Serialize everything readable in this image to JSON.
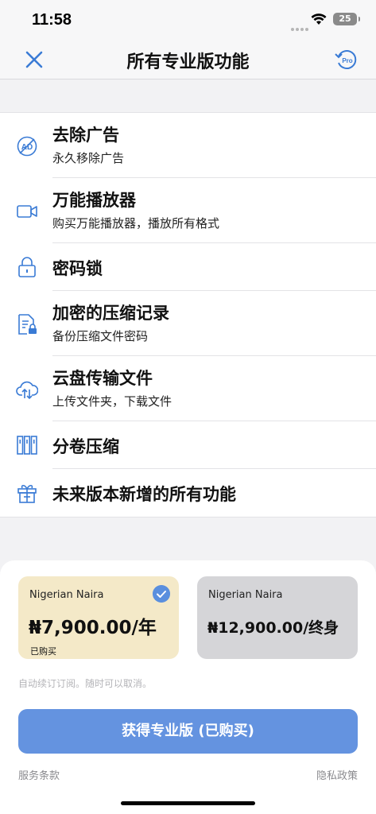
{
  "status_bar": {
    "time": "11:58",
    "battery": "25"
  },
  "nav": {
    "title": "所有专业版功能"
  },
  "features": [
    {
      "icon": "no-ads-icon",
      "title": "去除广告",
      "subtitle": "永久移除广告"
    },
    {
      "icon": "video-camera-icon",
      "title": "万能播放器",
      "subtitle": "购买万能播放器，播放所有格式"
    },
    {
      "icon": "lock-icon",
      "title": "密码锁"
    },
    {
      "icon": "encrypted-file-icon",
      "title": "加密的压缩记录",
      "subtitle": "备份压缩文件密码"
    },
    {
      "icon": "cloud-transfer-icon",
      "title": "云盘传输文件",
      "subtitle": "上传文件夹，下载文件"
    },
    {
      "icon": "split-volumes-icon",
      "title": "分卷压缩"
    },
    {
      "icon": "gift-icon",
      "title": "未来版本新增的所有功能"
    }
  ],
  "plans": {
    "yearly": {
      "currency": "Nigerian Naira",
      "price": "₦7,900.00/年",
      "status": "已购买",
      "selected": true
    },
    "lifetime": {
      "currency": "Nigerian Naira",
      "price": "₦12,900.00/终身",
      "selected": false
    }
  },
  "renew_note": "自动续订订阅。随时可以取消。",
  "cta_label": "获得专业版 (已购买)",
  "footer": {
    "terms": "服务条款",
    "privacy": "隐私政策"
  },
  "colors": {
    "accent": "#5a8fde",
    "cta": "#6493e0",
    "yearly_card": "#f4e9c8",
    "lifetime_card": "#d5d5d8"
  }
}
